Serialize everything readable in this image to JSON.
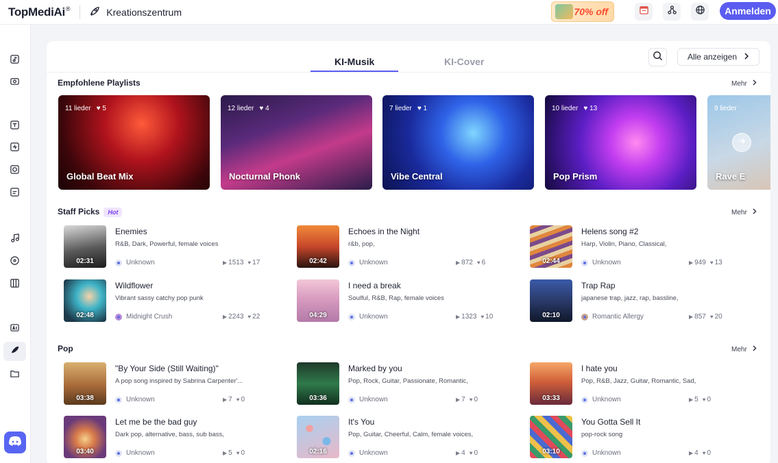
{
  "header": {
    "logo": "TopMediAi",
    "logo_mark": "®",
    "center_title": "Kreationszentrum",
    "promo_text": "70% off",
    "login_label": "Anmelden"
  },
  "tabs": [
    {
      "label": "KI-Musik",
      "active": true
    },
    {
      "label": "KI-Cover",
      "active": false
    }
  ],
  "show_all_label": "Alle anzeigen",
  "more_label": "Mehr",
  "playlists_section": {
    "title": "Empfohlene Playlists",
    "items": [
      {
        "name": "Global Beat Mix",
        "count": "11 lieder",
        "likes": "5"
      },
      {
        "name": "Nocturnal Phonk",
        "count": "12 lieder",
        "likes": "4"
      },
      {
        "name": "Vibe Central",
        "count": "7 lieder",
        "likes": "1"
      },
      {
        "name": "Pop Prism",
        "count": "10 lieder",
        "likes": "13"
      },
      {
        "name": "Rave E",
        "count": "9 lieder",
        "likes": ""
      }
    ]
  },
  "staff_section": {
    "title": "Staff Picks",
    "badge": "Hot",
    "songs": [
      {
        "title": "Enemies",
        "tags": "R&B, Dark, Powerful, female voices",
        "duration": "02:31",
        "author": "Unknown",
        "plays": "1513",
        "likes": "17"
      },
      {
        "title": "Echoes in the Night",
        "tags": "r&b, pop,",
        "duration": "02:42",
        "author": "Unknown",
        "plays": "872",
        "likes": "6"
      },
      {
        "title": "Helens song #2",
        "tags": "Harp, Violin, Piano, Classical,",
        "duration": "02:44",
        "author": "Unknown",
        "plays": "949",
        "likes": "13"
      },
      {
        "title": "Wildflower",
        "tags": "Vibrant sassy catchy pop punk",
        "duration": "02:48",
        "author": "Midnight Crush",
        "plays": "2243",
        "likes": "22"
      },
      {
        "title": "I need a break",
        "tags": "Soulful, R&B, Rap, female voices",
        "duration": "04:29",
        "author": "Unknown",
        "plays": "1323",
        "likes": "10"
      },
      {
        "title": "Trap Rap",
        "tags": "japanese trap, jazz, rap, bassline,",
        "duration": "02:10",
        "author": "Romantic Allergy",
        "plays": "857",
        "likes": "20"
      }
    ]
  },
  "pop_section": {
    "title": "Pop",
    "songs": [
      {
        "title": "\"By Your Side (Still Waiting)\"",
        "tags": "A pop song inspired by Sabrina Carpenter'...",
        "duration": "03:38",
        "author": "Unknown",
        "plays": "7",
        "likes": "0"
      },
      {
        "title": "Marked by you",
        "tags": "Pop, Rock, Guitar, Passionate, Romantic,",
        "duration": "03:36",
        "author": "Unknown",
        "plays": "7",
        "likes": "0"
      },
      {
        "title": "I hate you",
        "tags": "Pop, R&B, Jazz, Guitar, Romantic, Sad,",
        "duration": "03:33",
        "author": "Unknown",
        "plays": "5",
        "likes": "0"
      },
      {
        "title": "Let me be the bad guy",
        "tags": "Dark pop, alternative, bass, sub bass,",
        "duration": "03:40",
        "author": "Unknown",
        "plays": "5",
        "likes": "0"
      },
      {
        "title": "It's You",
        "tags": "Pop, Guitar, Cheerful, Calm, female voices,",
        "duration": "02:16",
        "author": "Unknown",
        "plays": "4",
        "likes": "0"
      },
      {
        "title": "You Gotta Sell It",
        "tags": "pop-rock song",
        "duration": "03:10",
        "author": "Unknown",
        "plays": "4",
        "likes": "0"
      }
    ]
  },
  "colors": {
    "accent": "#5b5cf0",
    "hot_text": "#7b3ff2",
    "promo": "#ff4a2e"
  }
}
